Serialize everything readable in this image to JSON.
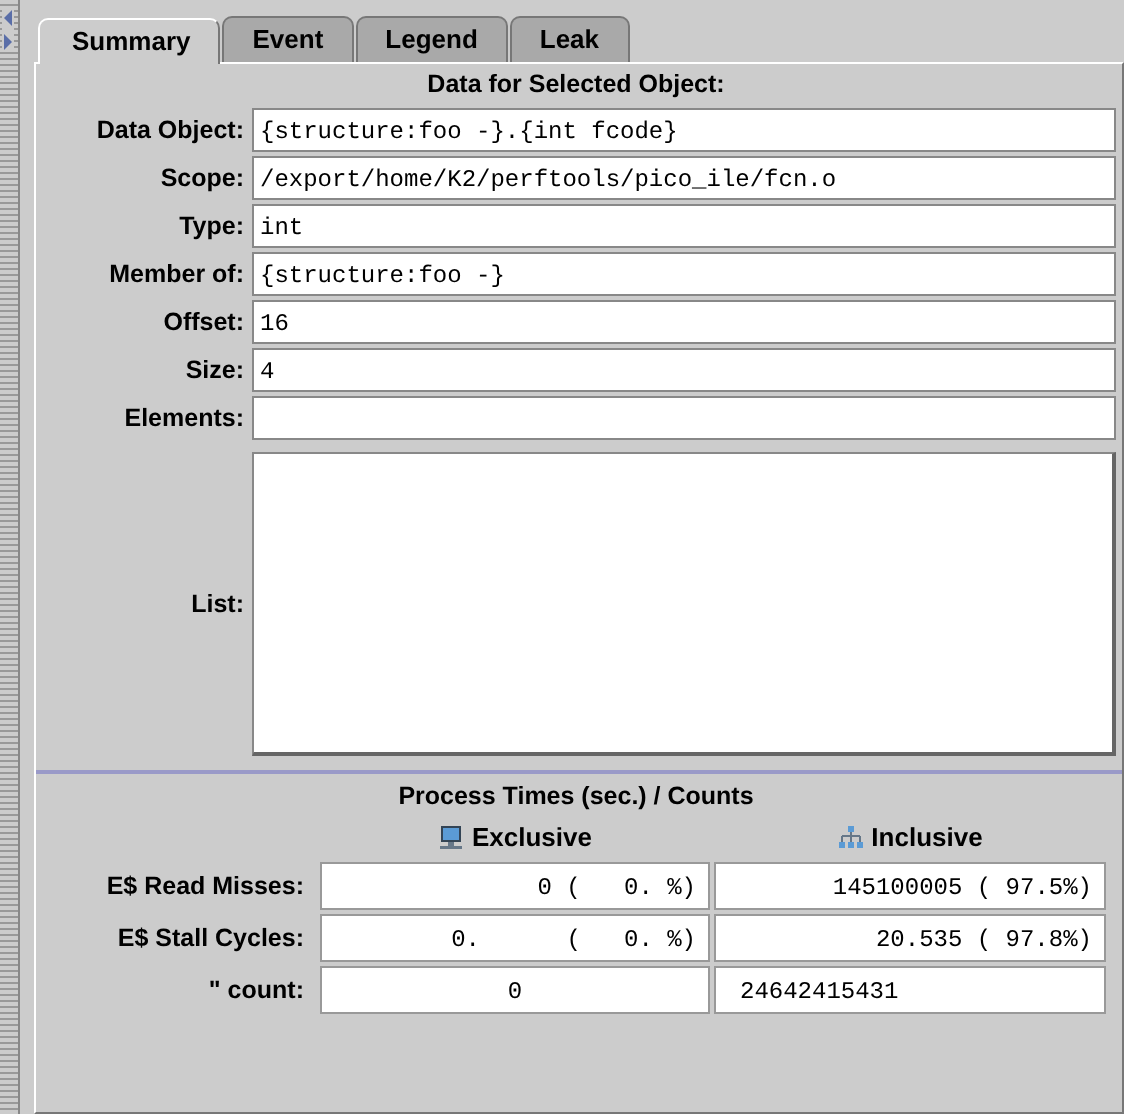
{
  "tabs": [
    {
      "label": "Summary",
      "selected": true
    },
    {
      "label": "Event",
      "selected": false
    },
    {
      "label": "Legend",
      "selected": false
    },
    {
      "label": "Leak",
      "selected": false
    }
  ],
  "summary": {
    "title": "Data for Selected Object:",
    "fields": [
      {
        "label": "Data Object:",
        "value": "{structure:foo -}.{int fcode}"
      },
      {
        "label": "Scope:",
        "value": "/export/home/K2/perftools/pico_ile/fcn.o"
      },
      {
        "label": "Type:",
        "value": "int"
      },
      {
        "label": "Member of:",
        "value": "{structure:foo -}"
      },
      {
        "label": "Offset:",
        "value": "16"
      },
      {
        "label": "Size:",
        "value": "4"
      },
      {
        "label": "Elements:"
      }
    ],
    "list_label": "List:"
  },
  "metrics": {
    "title": "Process Times (sec.) / Counts",
    "columns": [
      "Exclusive",
      "Inclusive"
    ],
    "rows": [
      {
        "kind": "percent",
        "label": "E$ Read Misses:",
        "exclusive": "0 (   0. %)",
        "inclusive": "145100005 ( 97.5%)"
      },
      {
        "kind": "percent",
        "label": "E$ Stall Cycles:",
        "exclusive": "0.      (   0. %)",
        "inclusive": "20.535 ( 97.8%)"
      },
      {
        "kind": "count",
        "label": "\" count:",
        "exclusive": "0",
        "inclusive": "24642415431"
      }
    ]
  }
}
